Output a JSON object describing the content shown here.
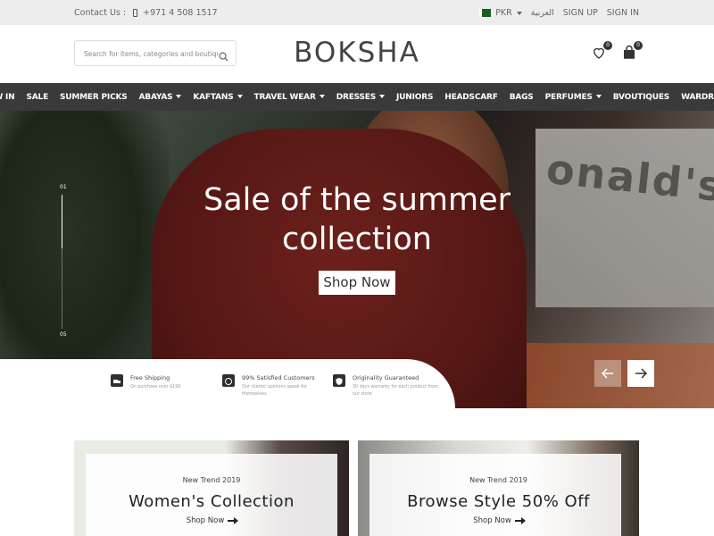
{
  "topbar": {
    "contact_label": "Contact Us :",
    "phone": "+971 4 508 1517",
    "currency": "PKR",
    "language": "العربية",
    "sign_up": "SIGN UP",
    "sign_in": "SIGN IN"
  },
  "header": {
    "search_placeholder": "Search for items, categories and boutiques",
    "logo": "BOKSHA",
    "wishlist_count": "0",
    "cart_count": "0"
  },
  "nav": {
    "items": [
      {
        "label": "NEW IN",
        "dropdown": false
      },
      {
        "label": "SALE",
        "dropdown": false
      },
      {
        "label": "SUMMER PICKS",
        "dropdown": false
      },
      {
        "label": "ABAYAS",
        "dropdown": true
      },
      {
        "label": "KAFTANS",
        "dropdown": true
      },
      {
        "label": "TRAVEL WEAR",
        "dropdown": true
      },
      {
        "label": "DRESSES",
        "dropdown": true
      },
      {
        "label": "JUNIORS",
        "dropdown": false
      },
      {
        "label": "HEADSCARF",
        "dropdown": false
      },
      {
        "label": "BAGS",
        "dropdown": false
      },
      {
        "label": "PERFUMES",
        "dropdown": true
      },
      {
        "label": "BVOUTIQUES",
        "dropdown": false
      },
      {
        "label": "WARDROBE",
        "dropdown": false
      }
    ]
  },
  "hero": {
    "title_line1": "Sale of the summer",
    "title_line2": "collection",
    "cta": "Shop Now",
    "slide_start": "01",
    "slide_end": "05",
    "progress_fraction": 0.4,
    "sign_text": "onald's"
  },
  "features": [
    {
      "icon": "truck-icon",
      "title": "Free Shipping",
      "subtitle": "On purchase over $199"
    },
    {
      "icon": "smile-icon",
      "title": "99% Satisfied Customers",
      "subtitle": "Our clients' opinions speak for themselves"
    },
    {
      "icon": "shield-icon",
      "title": "Originality Guaranteed",
      "subtitle": "30 days warranty for each product from our store"
    }
  ],
  "cards": [
    {
      "kicker": "New Trend 2019",
      "title": "Women's Collection",
      "link": "Shop Now"
    },
    {
      "kicker": "New Trend 2019",
      "title": "Browse Style 50% Off",
      "link": "Shop Now"
    }
  ],
  "colors": {
    "topbar_bg": "#ededed",
    "nav_bg": "#3a3a3a",
    "hero_shirt": "#6e1f1b"
  }
}
